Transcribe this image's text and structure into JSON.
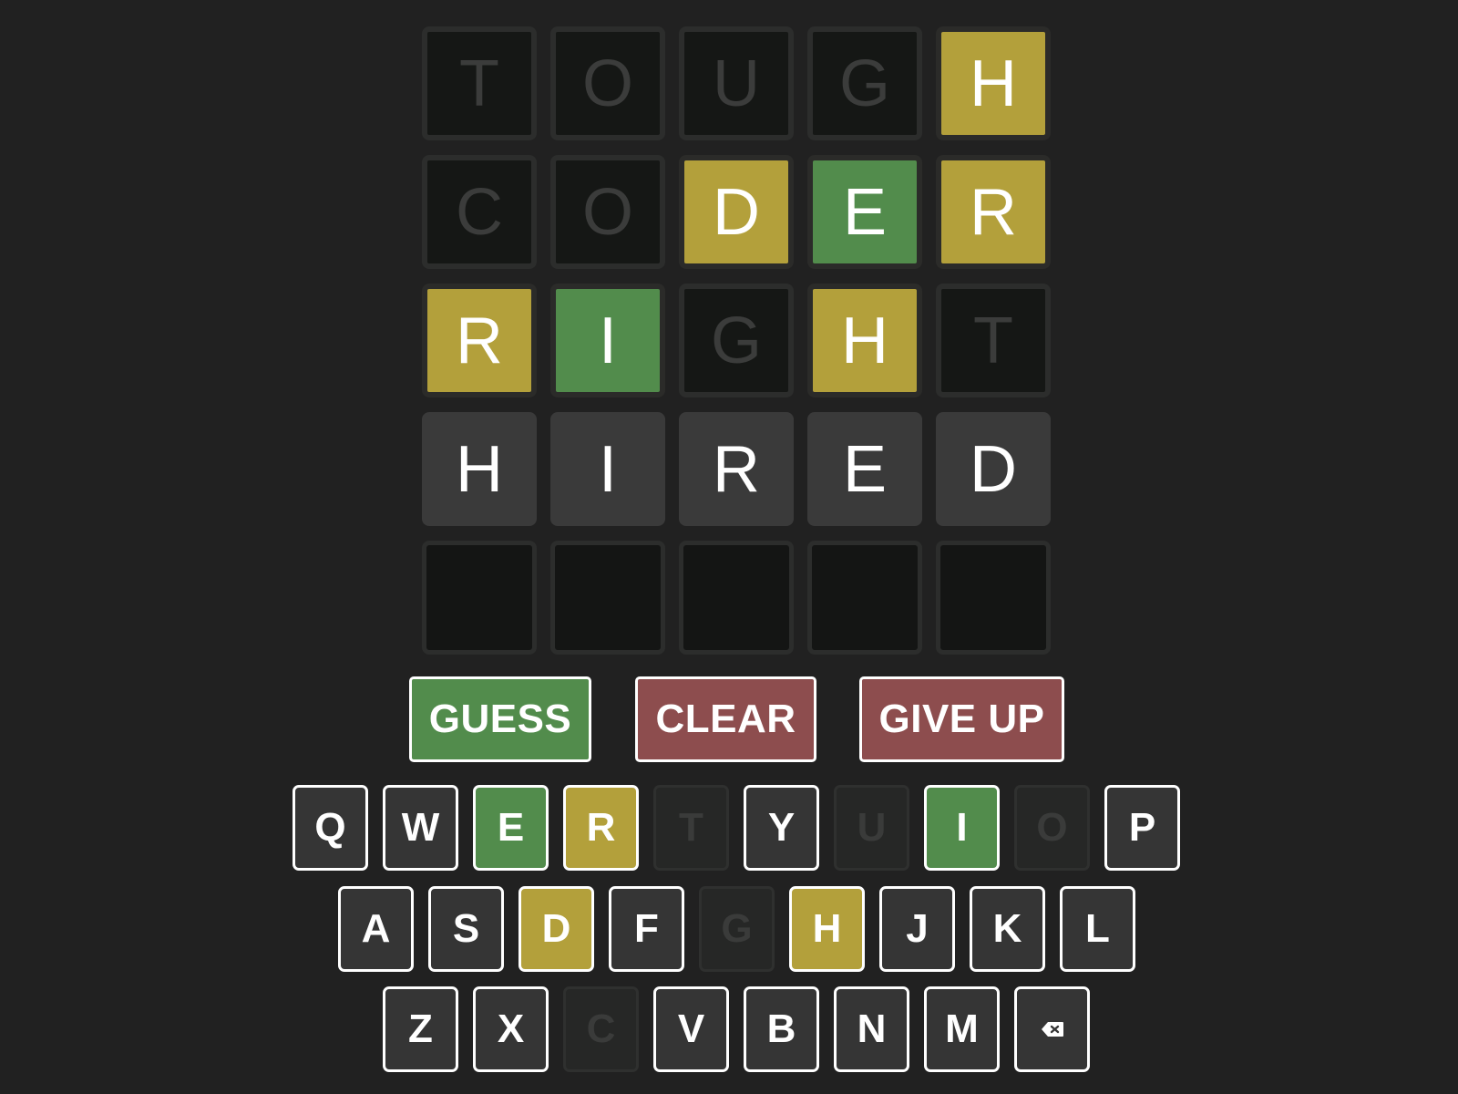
{
  "board": {
    "rows": [
      [
        {
          "letter": "T",
          "state": "absent"
        },
        {
          "letter": "O",
          "state": "absent"
        },
        {
          "letter": "U",
          "state": "absent"
        },
        {
          "letter": "G",
          "state": "absent"
        },
        {
          "letter": "H",
          "state": "present"
        }
      ],
      [
        {
          "letter": "C",
          "state": "absent"
        },
        {
          "letter": "O",
          "state": "absent"
        },
        {
          "letter": "D",
          "state": "present"
        },
        {
          "letter": "E",
          "state": "correct"
        },
        {
          "letter": "R",
          "state": "present"
        }
      ],
      [
        {
          "letter": "R",
          "state": "present"
        },
        {
          "letter": "I",
          "state": "correct"
        },
        {
          "letter": "G",
          "state": "absent"
        },
        {
          "letter": "H",
          "state": "present"
        },
        {
          "letter": "T",
          "state": "absent"
        }
      ],
      [
        {
          "letter": "H",
          "state": "pending"
        },
        {
          "letter": "I",
          "state": "pending"
        },
        {
          "letter": "R",
          "state": "pending"
        },
        {
          "letter": "E",
          "state": "pending"
        },
        {
          "letter": "D",
          "state": "pending"
        }
      ],
      [
        {
          "letter": "",
          "state": "empty"
        },
        {
          "letter": "",
          "state": "empty"
        },
        {
          "letter": "",
          "state": "empty"
        },
        {
          "letter": "",
          "state": "empty"
        },
        {
          "letter": "",
          "state": "empty"
        }
      ]
    ]
  },
  "actions": {
    "guess_label": "GUESS",
    "clear_label": "CLEAR",
    "give_up_label": "GIVE UP"
  },
  "keyboard": {
    "rows": [
      [
        {
          "key": "Q",
          "state": "unused"
        },
        {
          "key": "W",
          "state": "unused"
        },
        {
          "key": "E",
          "state": "correct"
        },
        {
          "key": "R",
          "state": "present"
        },
        {
          "key": "T",
          "state": "absent"
        },
        {
          "key": "Y",
          "state": "unused"
        },
        {
          "key": "U",
          "state": "absent"
        },
        {
          "key": "I",
          "state": "correct"
        },
        {
          "key": "O",
          "state": "absent"
        },
        {
          "key": "P",
          "state": "unused"
        }
      ],
      [
        {
          "key": "A",
          "state": "unused"
        },
        {
          "key": "S",
          "state": "unused"
        },
        {
          "key": "D",
          "state": "present"
        },
        {
          "key": "F",
          "state": "unused"
        },
        {
          "key": "G",
          "state": "absent"
        },
        {
          "key": "H",
          "state": "present"
        },
        {
          "key": "J",
          "state": "unused"
        },
        {
          "key": "K",
          "state": "unused"
        },
        {
          "key": "L",
          "state": "unused"
        }
      ],
      [
        {
          "key": "Z",
          "state": "unused"
        },
        {
          "key": "X",
          "state": "unused"
        },
        {
          "key": "C",
          "state": "absent"
        },
        {
          "key": "V",
          "state": "unused"
        },
        {
          "key": "B",
          "state": "unused"
        },
        {
          "key": "N",
          "state": "unused"
        },
        {
          "key": "M",
          "state": "unused"
        },
        {
          "key": "",
          "state": "unused",
          "icon": "backspace-icon"
        }
      ]
    ]
  },
  "colors": {
    "background": "#212121",
    "correct": "#528c4c",
    "present": "#b3a03b",
    "absent_tile": "#151715",
    "pending_tile": "#3a3a3a",
    "key_default": "#353535",
    "danger_button": "#8d4d4e"
  }
}
